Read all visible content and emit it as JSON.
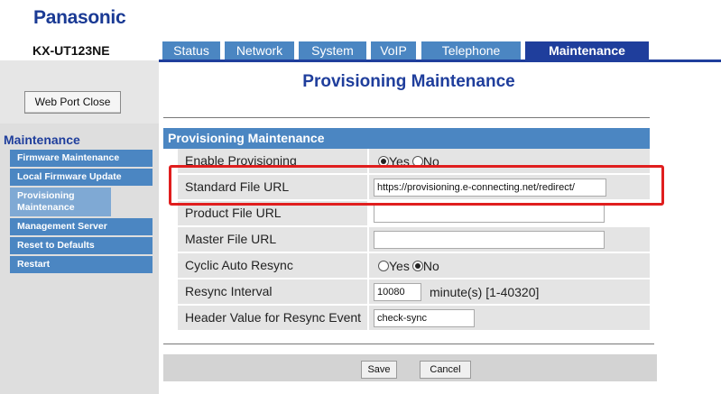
{
  "header": {
    "brand": "Panasonic",
    "model": "KX-UT123NE"
  },
  "tabs": [
    {
      "label": "Status"
    },
    {
      "label": "Network"
    },
    {
      "label": "System"
    },
    {
      "label": "VoIP"
    },
    {
      "label": "Telephone"
    },
    {
      "label": "Maintenance",
      "active": true
    }
  ],
  "sidebar": {
    "web_port_button": "Web Port Close",
    "section_title": "Maintenance",
    "items": [
      {
        "label": "Firmware Maintenance"
      },
      {
        "label": "Local Firmware Update"
      },
      {
        "label": "Provisioning Maintenance",
        "active": true
      },
      {
        "label": "Management Server"
      },
      {
        "label": "Reset to Defaults"
      },
      {
        "label": "Restart"
      }
    ]
  },
  "main": {
    "page_title": "Provisioning Maintenance",
    "section_title": "Provisioning Maintenance",
    "fields": {
      "enable_provisioning": {
        "label": "Enable Provisioning",
        "options": [
          "Yes",
          "No"
        ],
        "selected": "Yes"
      },
      "standard_file_url": {
        "label": "Standard File URL",
        "value": "https://provisioning.e-connecting.net/redirect/"
      },
      "product_file_url": {
        "label": "Product File URL",
        "value": ""
      },
      "master_file_url": {
        "label": "Master File URL",
        "value": ""
      },
      "cyclic_auto_resync": {
        "label": "Cyclic Auto Resync",
        "options": [
          "Yes",
          "No"
        ],
        "selected": "No"
      },
      "resync_interval": {
        "label": "Resync Interval",
        "value": "10080",
        "hint": "minute(s) [1-40320]"
      },
      "header_value_resync": {
        "label": "Header Value for Resync Event",
        "value": "check-sync"
      }
    }
  },
  "footer": {
    "save_label": "Save",
    "cancel_label": "Cancel"
  },
  "colors": {
    "brand": "#1a3a94",
    "tab": "#4b86c2",
    "tab_active": "#1f3e9c",
    "highlight": "#e01e1e"
  }
}
